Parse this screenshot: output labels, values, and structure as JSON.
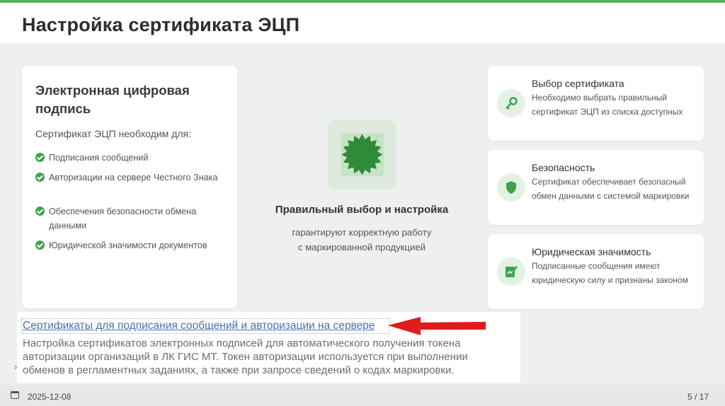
{
  "header": {
    "title": "Настройка сертификата ЭЦП"
  },
  "left_card": {
    "title": "Электронная цифровая подпись",
    "subtitle": "Сертификат ЭЦП необходим для:",
    "items": [
      "Подписания сообщений",
      "Авторизации на сервере Честного Знака",
      "Обеспечения безопасности обмена данными",
      "Юридической значимости документов"
    ]
  },
  "center": {
    "icon": "seal-icon",
    "title": "Правильный выбор и настройка",
    "text_line1": "гарантируют корректную работу",
    "text_line2": "с маркированной продукцией"
  },
  "right_cards": [
    {
      "icon": "key-icon",
      "title": "Выбор сертификата",
      "text": "Необходимо выбрать правильный сертификат ЭЦП из списка доступных"
    },
    {
      "icon": "shield-icon",
      "title": "Безопасность",
      "text": "Сертификат обеспечивает безопасный обмен данными с системой маркировки"
    },
    {
      "icon": "signature-icon",
      "title": "Юридическая значимость",
      "text": "Подписанные сообщения имеют юридическую силу и признаны законом"
    }
  ],
  "screenshot": {
    "link": "Сертификаты для подписания сообщений и авторизации на сервере",
    "text": "Настройка сертификатов электронных подписей для автоматического получения токена авторизации организаций в ЛК ГИС МТ. Токен авторизации используется при выполнении обменов в регламентных заданиях, а также при запросе сведений о кодах маркировки.",
    "caret": "›"
  },
  "footer": {
    "date": "2025-12-08",
    "page": "5 / 17"
  },
  "colors": {
    "accent": "#55b65a",
    "check": "#3fa34d",
    "arrow": "#e01b1b",
    "link": "#4b6fae"
  }
}
